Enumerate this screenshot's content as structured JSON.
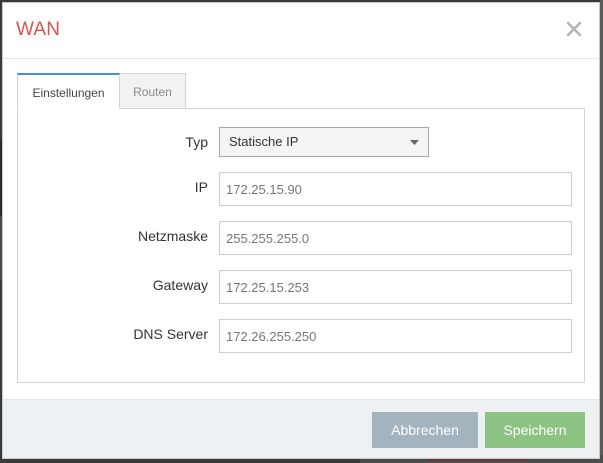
{
  "dialog": {
    "title": "WAN",
    "title_color": "#d9534f"
  },
  "tabs": [
    {
      "label": "Einstellungen",
      "active": true
    },
    {
      "label": "Routen",
      "active": false
    }
  ],
  "form": {
    "type": {
      "label": "Typ",
      "selected": "Statische IP"
    },
    "ip": {
      "label": "IP",
      "value": "172.25.15.90"
    },
    "netmask": {
      "label": "Netzmaske",
      "value": "255.255.255.0"
    },
    "gateway": {
      "label": "Gateway",
      "value": "172.25.15.253"
    },
    "dns": {
      "label": "DNS Server",
      "value": "172.26.255.250"
    }
  },
  "footer": {
    "cancel_label": "Abbrechen",
    "save_label": "Speichern"
  },
  "icons": {
    "close": "close-icon",
    "select_caret": "caret-down-icon"
  },
  "colors": {
    "accent_tab": "#4a8fd6",
    "cancel_button": "#a3b4bf",
    "save_button": "#8cc282"
  }
}
